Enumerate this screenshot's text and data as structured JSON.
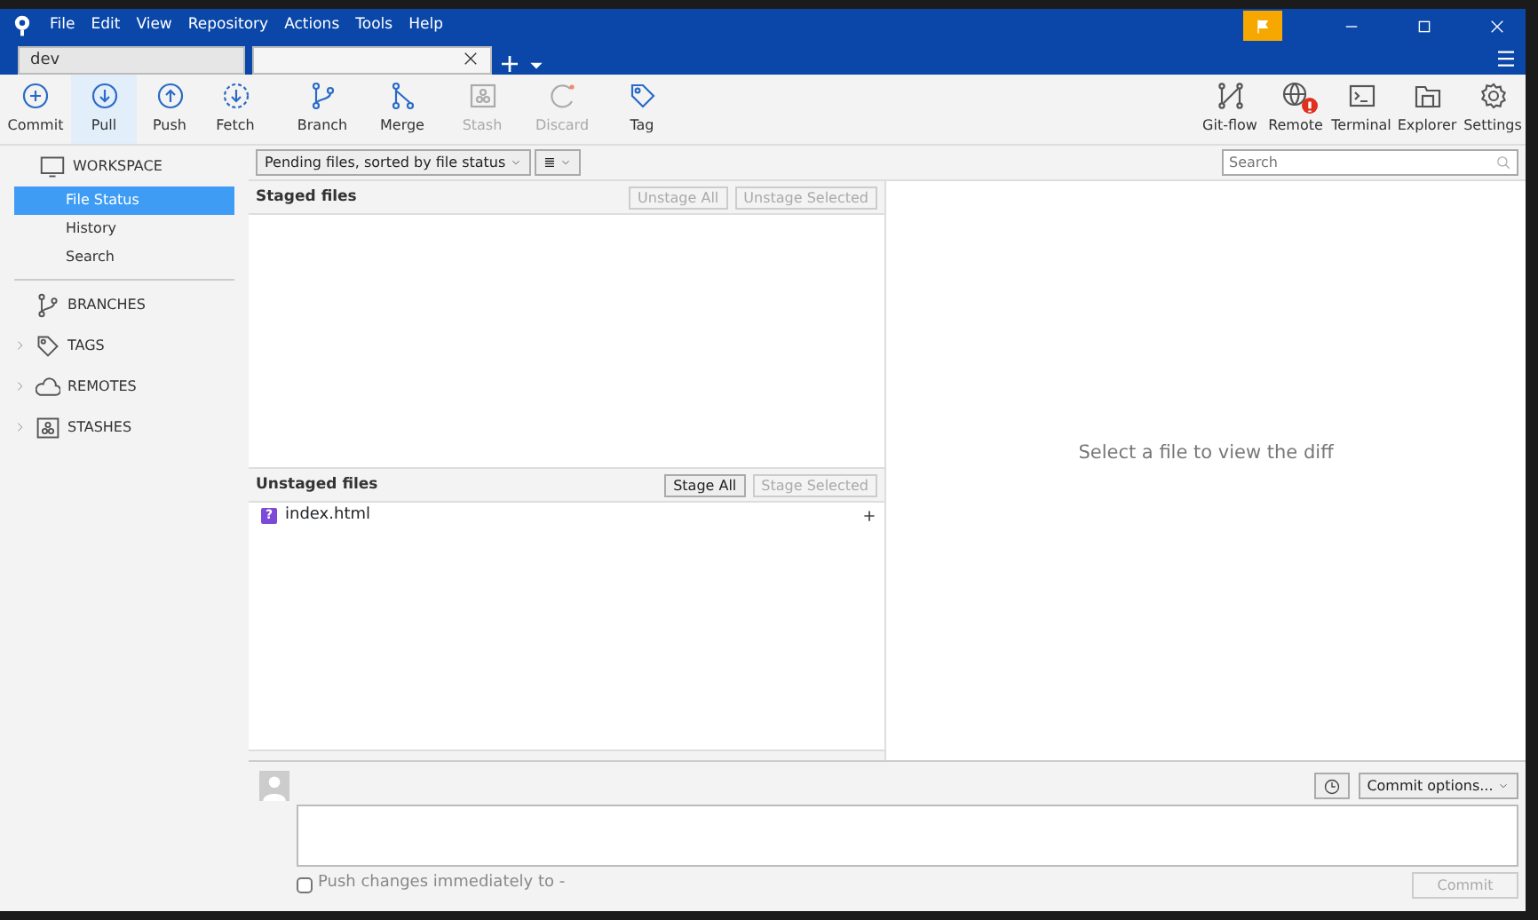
{
  "menu": [
    "File",
    "Edit",
    "View",
    "Repository",
    "Actions",
    "Tools",
    "Help"
  ],
  "tabs": [
    {
      "label": "dev",
      "selected": false
    },
    {
      "selected": true
    }
  ],
  "toolbar_left": [
    {
      "label": "Commit",
      "selected": false,
      "disabled": false
    },
    {
      "label": "Pull",
      "selected": true,
      "disabled": false
    },
    {
      "label": "Push",
      "selected": false,
      "disabled": false
    },
    {
      "label": "Fetch",
      "selected": false,
      "disabled": false
    },
    {
      "label": "Branch",
      "selected": false,
      "disabled": false
    },
    {
      "label": "Merge",
      "selected": false,
      "disabled": false
    },
    {
      "label": "Stash",
      "selected": false,
      "disabled": true
    },
    {
      "label": "Discard",
      "selected": false,
      "disabled": true
    },
    {
      "label": "Tag",
      "selected": false,
      "disabled": false
    }
  ],
  "toolbar_right": [
    {
      "label": "Git-flow"
    },
    {
      "label": "Remote"
    },
    {
      "label": "Terminal"
    },
    {
      "label": "Explorer"
    },
    {
      "label": "Settings"
    }
  ],
  "sidebar": {
    "workspace": {
      "label": "WORKSPACE",
      "items": [
        {
          "label": "File Status",
          "selected": true
        },
        {
          "label": "History",
          "selected": false
        },
        {
          "label": "Search",
          "selected": false
        }
      ]
    },
    "sections": [
      {
        "label": "BRANCHES",
        "expandable": false
      },
      {
        "label": "TAGS",
        "expandable": true
      },
      {
        "label": "REMOTES",
        "expandable": true
      },
      {
        "label": "STASHES",
        "expandable": true
      }
    ]
  },
  "filter": {
    "sort": "Pending files, sorted by file status",
    "view": "≣"
  },
  "search": {
    "placeholder": "Search"
  },
  "staged": {
    "title": "Staged files",
    "buttons": [
      {
        "label": "Unstage All",
        "disabled": true
      },
      {
        "label": "Unstage Selected",
        "disabled": true
      }
    ]
  },
  "unstaged": {
    "title": "Unstaged files",
    "buttons": [
      {
        "label": "Stage All",
        "disabled": false
      },
      {
        "label": "Stage Selected",
        "disabled": true
      }
    ],
    "files": [
      {
        "name": "index.html",
        "status": "?"
      }
    ]
  },
  "diff": {
    "message": "Select a file to view the diff"
  },
  "commit": {
    "options": "Commit options...",
    "push_label": "Push changes immediately to -",
    "push_checked": false,
    "button": "Commit",
    "button_disabled": true
  }
}
